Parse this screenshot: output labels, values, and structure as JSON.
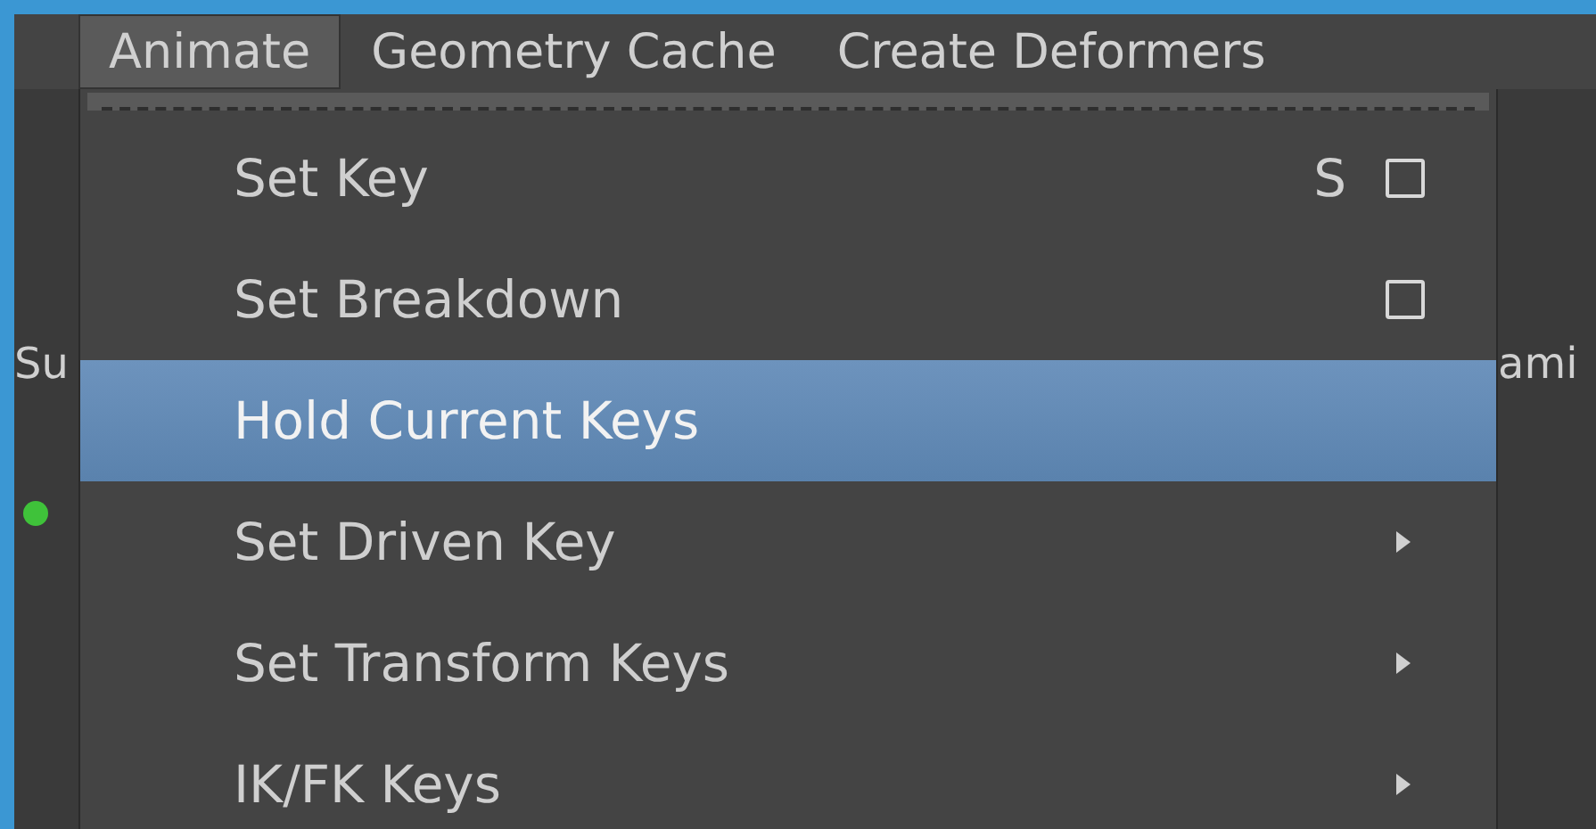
{
  "menubar": [
    {
      "label": "Animate",
      "selected": true
    },
    {
      "label": "Geometry Cache",
      "selected": false
    },
    {
      "label": "Create Deformers",
      "selected": false
    }
  ],
  "background": {
    "left_label": "Su",
    "right_label": "ami"
  },
  "menu": {
    "items": [
      {
        "label": "Set Key",
        "shortcut": "S",
        "kind": "option",
        "selected": false
      },
      {
        "label": "Set Breakdown",
        "kind": "option",
        "selected": false
      },
      {
        "label": "Hold Current Keys",
        "kind": "plain",
        "selected": true
      },
      {
        "label": "Set Driven Key",
        "kind": "submenu",
        "selected": false
      },
      {
        "label": "Set Transform Keys",
        "kind": "submenu",
        "selected": false
      },
      {
        "label": "IK/FK Keys",
        "kind": "submenu",
        "selected": false
      }
    ]
  }
}
